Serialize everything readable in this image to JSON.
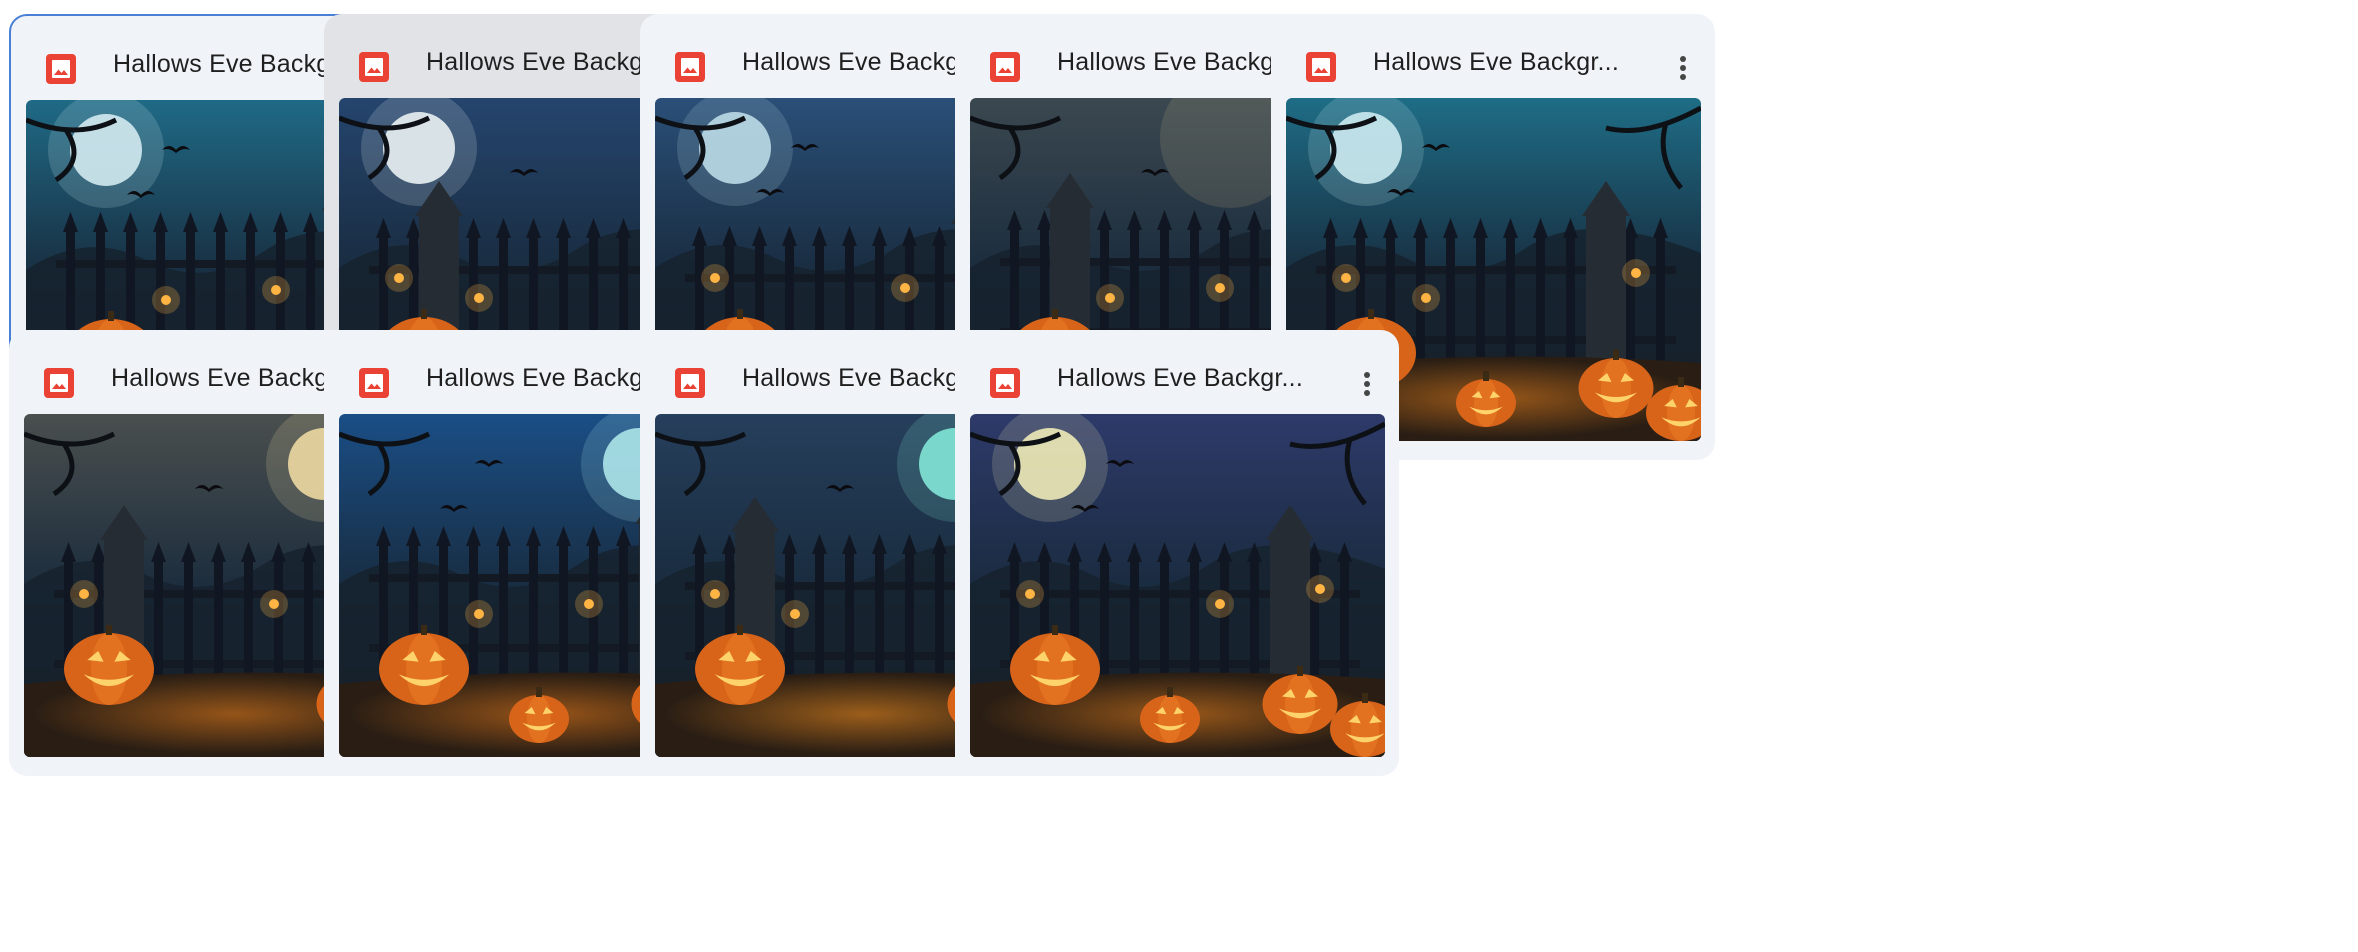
{
  "files": [
    {
      "title": "Hallows Eve Backgr...",
      "icon": "image-file-icon",
      "selected": true,
      "hovered": false,
      "scene": {
        "sky": "#1f6a86",
        "moon": "left",
        "moonColor": "#cfe7ee",
        "glow": "#e07a1c"
      }
    },
    {
      "title": "Hallows Eve Backgr...",
      "icon": "image-file-icon",
      "selected": false,
      "hovered": true,
      "scene": {
        "sky": "#25456e",
        "moon": "left",
        "moonColor": "#e6eef0",
        "glow": "#e58722"
      }
    },
    {
      "title": "Hallows Eve Backgr...",
      "icon": "image-file-icon",
      "selected": false,
      "hovered": false,
      "scene": {
        "sky": "#2a4f78",
        "moon": "left",
        "moonColor": "#b9d8e4",
        "glow": "#e67b1d"
      }
    },
    {
      "title": "Hallows Eve Backgr...",
      "icon": "image-file-icon",
      "selected": false,
      "hovered": false,
      "scene": {
        "sky": "#3b4850",
        "moon": "none",
        "moonColor": "#d9c48a",
        "glow": "#d7871f"
      }
    },
    {
      "title": "Hallows Eve Backgr...",
      "icon": "image-file-icon",
      "selected": false,
      "hovered": false,
      "scene": {
        "sky": "#1e6d86",
        "moon": "left",
        "moonColor": "#c9e7ee",
        "glow": "#e07d1c"
      }
    },
    {
      "title": "Hallows Eve Backgr...",
      "icon": "image-file-icon",
      "selected": false,
      "hovered": false,
      "scene": {
        "sky": "#4a4f4e",
        "moon": "right",
        "moonColor": "#e9d6a0",
        "glow": "#de7a1c"
      }
    },
    {
      "title": "Hallows Eve Backgr...",
      "icon": "image-file-icon",
      "selected": false,
      "hovered": false,
      "scene": {
        "sky": "#1a4e86",
        "moon": "right",
        "moonColor": "#a9e2e7",
        "glow": "#e0781b"
      }
    },
    {
      "title": "Hallows Eve Backgr...",
      "icon": "image-file-icon",
      "selected": false,
      "hovered": false,
      "scene": {
        "sky": "#263f5c",
        "moon": "right",
        "moonColor": "#7fe3d4",
        "glow": "#e8891f"
      }
    },
    {
      "title": "Hallows Eve Backgr...",
      "icon": "image-file-icon",
      "selected": false,
      "hovered": false,
      "scene": {
        "sky": "#2e3a6a",
        "moon": "left",
        "moonColor": "#e9e6b4",
        "glow": "#e07d1c"
      }
    }
  ],
  "colors": {
    "card_background": "#f0f4f9",
    "card_hover": "#e1e3e6",
    "selected_border": "#4a7fd6",
    "file_icon_red": "#ea4335",
    "title_text": "#1f1f1f",
    "more_icon": "#444746"
  },
  "menu_icon": "more-vert-icon"
}
